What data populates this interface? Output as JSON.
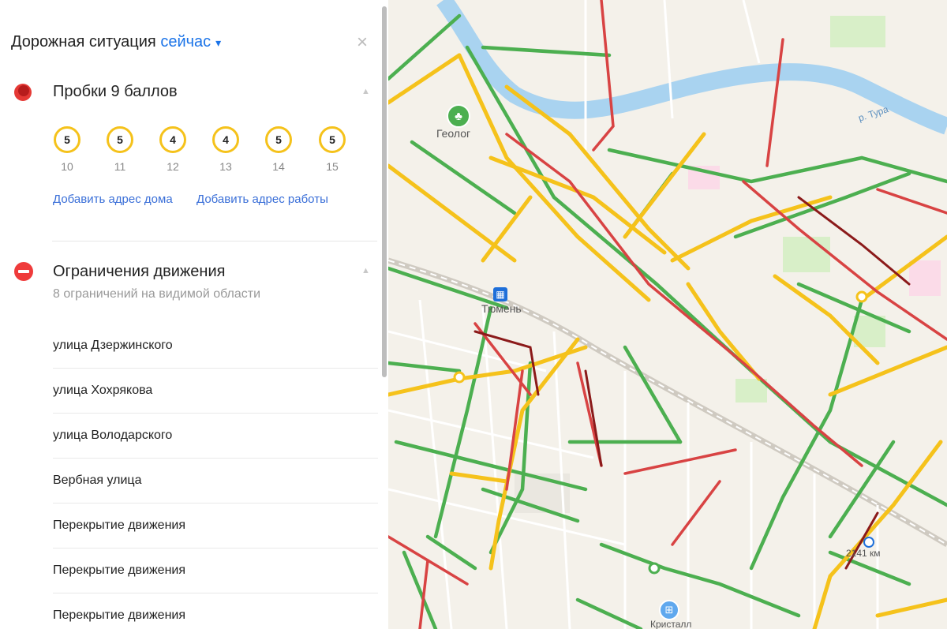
{
  "header": {
    "title": "Дорожная ситуация",
    "selector": "сейчас",
    "caret": "▾",
    "close": "×"
  },
  "traffic": {
    "title": "Пробки 9 баллов",
    "collapse": "▲",
    "forecast": [
      {
        "score": "5",
        "hour": "10"
      },
      {
        "score": "5",
        "hour": "11"
      },
      {
        "score": "4",
        "hour": "12"
      },
      {
        "score": "4",
        "hour": "13"
      },
      {
        "score": "5",
        "hour": "14"
      },
      {
        "score": "5",
        "hour": "15"
      }
    ],
    "add_home": "Добавить адрес дома",
    "add_work": "Добавить адрес работы"
  },
  "restrictions": {
    "title": "Ограничения движения",
    "subtitle": "8 ограничений на видимой области",
    "collapse": "▲",
    "items": [
      "улица Дзержинского",
      "улица Хохрякова",
      "улица Володарского",
      "Вербная улица",
      "Перекрытие движения",
      "Перекрытие движения",
      "Перекрытие движения"
    ]
  },
  "map": {
    "labels": {
      "geolog": "Геолог",
      "tyumen": "Тюмень",
      "river": "р. Тура",
      "station": "2141 км",
      "shop": "Кристалл"
    },
    "icons": {
      "park": "tree-icon",
      "rail": "train-icon",
      "shop": "shopping-icon"
    },
    "colors": {
      "free": "#4caf50",
      "slow": "#f5c21b",
      "jam": "#d84343",
      "severe": "#8b1a1a",
      "river": "#a9d3f0",
      "base": "#f4f1ea"
    }
  }
}
